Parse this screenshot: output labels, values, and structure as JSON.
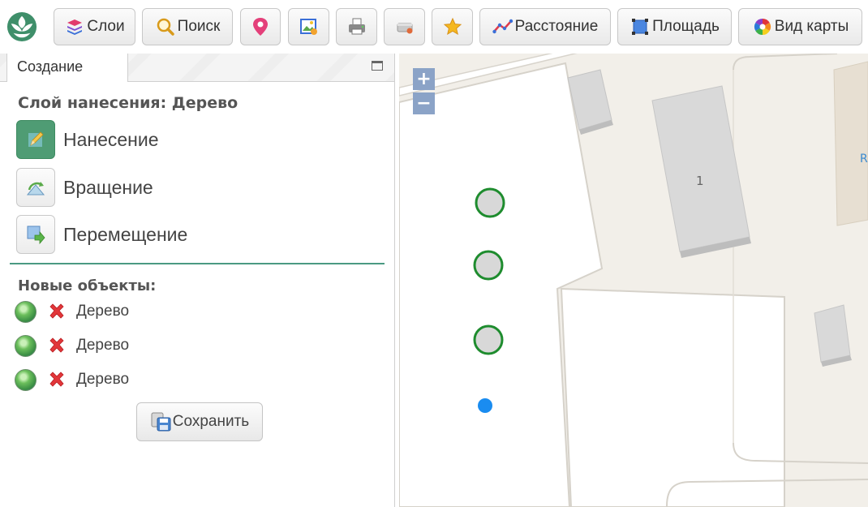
{
  "toolbar": {
    "buttons": [
      {
        "id": "layers",
        "label": "Слои",
        "icon": "layers-icon"
      },
      {
        "id": "search",
        "label": "Поиск",
        "icon": "search-icon"
      },
      {
        "id": "marker",
        "label": "",
        "icon": "map-pin-icon"
      },
      {
        "id": "image",
        "label": "",
        "icon": "picture-icon"
      },
      {
        "id": "print",
        "label": "",
        "icon": "printer-icon"
      },
      {
        "id": "eraser",
        "label": "",
        "icon": "eraser-icon"
      },
      {
        "id": "favorites",
        "label": "",
        "icon": "star-icon"
      },
      {
        "id": "distance",
        "label": "Расстояние",
        "icon": "ruler-line-icon"
      },
      {
        "id": "area",
        "label": "Площадь",
        "icon": "polygon-area-icon"
      },
      {
        "id": "mapview",
        "label": "Вид карты",
        "icon": "color-wheel-icon"
      }
    ]
  },
  "panel": {
    "tab_label": "Создание",
    "layer_title": "Слой нанесения: Дерево",
    "tools": [
      {
        "id": "draw",
        "label": "Нанесение",
        "active": true
      },
      {
        "id": "rotate",
        "label": "Вращение",
        "active": false
      },
      {
        "id": "move",
        "label": "Перемещение",
        "active": false
      }
    ],
    "new_objects_title": "Новые объекты:",
    "objects": [
      {
        "label": "Дерево"
      },
      {
        "label": "Дерево"
      },
      {
        "label": "Дерево"
      }
    ],
    "save_label": "Сохранить"
  },
  "map": {
    "zoom_in": "+",
    "zoom_out": "−",
    "building_label": "1",
    "edge_label": "R",
    "colors": {
      "marker_stroke": "#1e8c2e",
      "marker_fill": "#d8d8d8",
      "cursor": "#1a8cf0",
      "zoom_bg": "#8ba3c7"
    }
  }
}
